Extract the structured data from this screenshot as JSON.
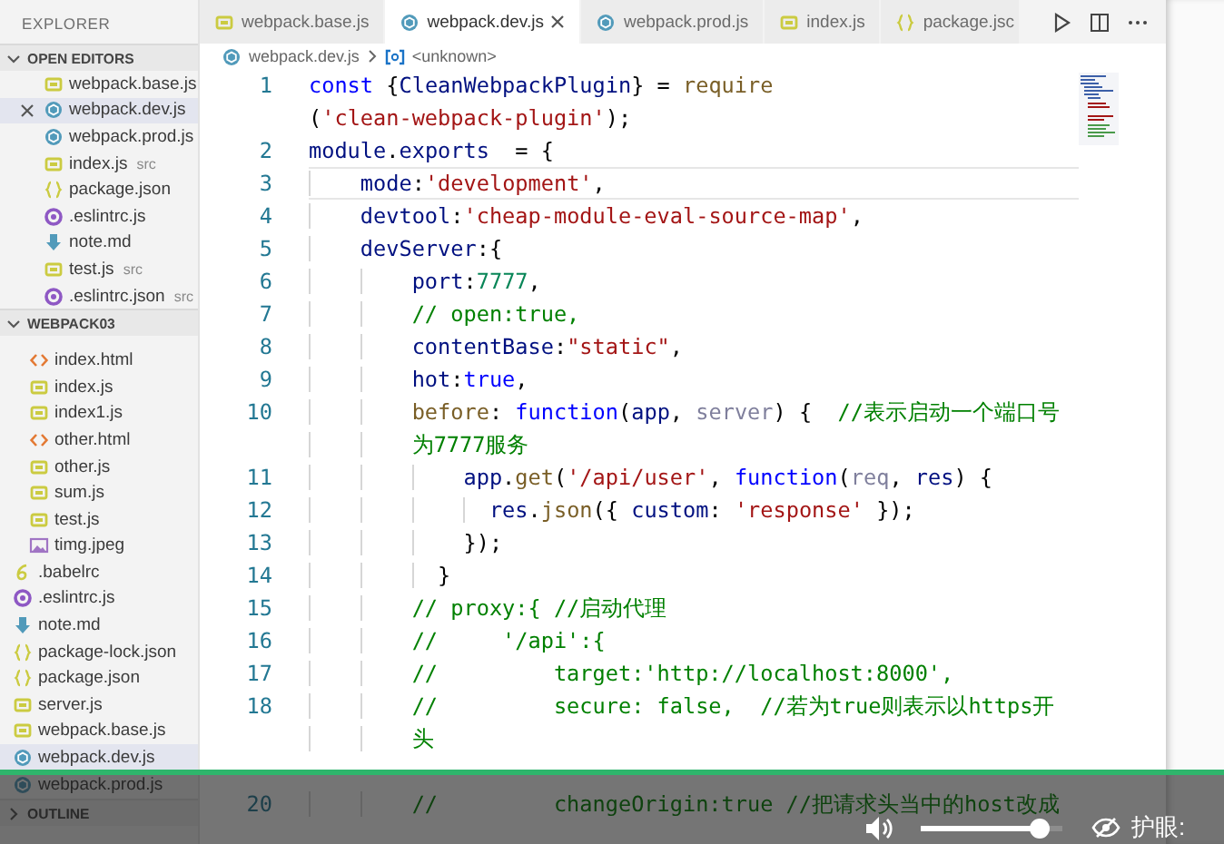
{
  "sidebar": {
    "title": "EXPLORER",
    "sections": [
      {
        "label": "OPEN EDITORS",
        "kind": "open-editors",
        "expanded": true,
        "items": [
          {
            "label": "webpack.base.js",
            "kind": "js",
            "selected": false
          },
          {
            "label": "webpack.dev.js",
            "kind": "webpack",
            "selected": true
          },
          {
            "label": "webpack.prod.js",
            "kind": "webpack",
            "selected": false
          },
          {
            "label": "index.js",
            "kind": "js",
            "description": "src",
            "selected": false
          },
          {
            "label": "package.json",
            "kind": "json",
            "selected": false
          },
          {
            "label": ".eslintrc.js",
            "kind": "eslint",
            "selected": false
          },
          {
            "label": "note.md",
            "kind": "markdown",
            "selected": false
          },
          {
            "label": "test.js",
            "kind": "js",
            "description": "src",
            "selected": false
          },
          {
            "label": ".eslintrc.json",
            "kind": "eslint",
            "description": "src",
            "selected": false
          }
        ]
      },
      {
        "label": "WEBPACK03",
        "kind": "folder",
        "expanded": true,
        "items": [
          {
            "children": [
              {
                "label": "index.html",
                "kind": "html",
                "selected": false
              },
              {
                "label": "index.js",
                "kind": "js",
                "selected": false
              },
              {
                "label": "index1.js",
                "kind": "js",
                "selected": false
              },
              {
                "label": "other.html",
                "kind": "html",
                "selected": false
              },
              {
                "label": "other.js",
                "kind": "js",
                "selected": false
              },
              {
                "label": "sum.js",
                "kind": "js",
                "selected": false
              },
              {
                "label": "test.js",
                "kind": "js",
                "selected": false
              },
              {
                "label": "timg.jpeg",
                "kind": "image",
                "selected": false
              }
            ]
          },
          {
            "label": ".babelrc",
            "kind": "babel",
            "selected": false
          },
          {
            "label": ".eslintrc.js",
            "kind": "eslint",
            "selected": false
          },
          {
            "label": "note.md",
            "kind": "markdown",
            "selected": false
          },
          {
            "label": "package-lock.json",
            "kind": "json",
            "selected": false
          },
          {
            "label": "package.json",
            "kind": "json",
            "selected": false
          },
          {
            "label": "server.js",
            "kind": "js",
            "selected": false
          },
          {
            "label": "webpack.base.js",
            "kind": "js",
            "selected": false
          },
          {
            "label": "webpack.dev.js",
            "kind": "webpack",
            "selected": true
          },
          {
            "label": "webpack.prod.js",
            "kind": "webpack",
            "selected": false
          }
        ]
      },
      {
        "label": "OUTLINE",
        "kind": "outline",
        "expanded": false
      }
    ]
  },
  "tabs": [
    {
      "label": "webpack.base.js",
      "kind": "js",
      "selected": false
    },
    {
      "label": "webpack.dev.js",
      "kind": "webpack",
      "selected": true
    },
    {
      "label": "webpack.prod.js",
      "kind": "webpack",
      "selected": false
    },
    {
      "label": "index.js",
      "kind": "js",
      "selected": false
    },
    {
      "label": "package.jsc",
      "kind": "json",
      "selected": false
    }
  ],
  "breadcrumb": {
    "file": "webpack.dev.js",
    "symbol": "<unknown>"
  },
  "code": {
    "lines": [
      {
        "number": "1",
        "current": false,
        "rows": [
          [
            {
              "text": "const",
              "kind": "keyword"
            },
            {
              "text": " {",
              "kind": "plain"
            },
            {
              "text": "CleanWebpackPlugin",
              "kind": "variable"
            },
            {
              "text": "} = ",
              "kind": "plain"
            },
            {
              "text": "require",
              "kind": "function"
            }
          ],
          [
            {
              "text": "(",
              "kind": "plain"
            },
            {
              "text": "'clean-webpack-plugin'",
              "kind": "string"
            },
            {
              "text": ");",
              "kind": "plain"
            }
          ]
        ]
      },
      {
        "number": "2",
        "current": false,
        "rows": [
          [
            {
              "text": "module",
              "kind": "variable"
            },
            {
              "text": ".",
              "kind": "plain"
            },
            {
              "text": "exports",
              "kind": "variable"
            },
            {
              "text": "  = {",
              "kind": "plain"
            }
          ]
        ]
      },
      {
        "number": "3",
        "current": true,
        "rows": [
          [
            {
              "text": "    ",
              "kind": "indent"
            },
            {
              "text": "mode",
              "kind": "variable"
            },
            {
              "text": ":",
              "kind": "plain"
            },
            {
              "text": "'development'",
              "kind": "string"
            },
            {
              "text": ",",
              "kind": "plain"
            }
          ]
        ]
      },
      {
        "number": "4",
        "current": false,
        "rows": [
          [
            {
              "text": "    ",
              "kind": "indent"
            },
            {
              "text": "devtool",
              "kind": "variable"
            },
            {
              "text": ":",
              "kind": "plain"
            },
            {
              "text": "'cheap-module-eval-source-map'",
              "kind": "string"
            },
            {
              "text": ",",
              "kind": "plain"
            }
          ]
        ]
      },
      {
        "number": "5",
        "current": false,
        "rows": [
          [
            {
              "text": "    ",
              "kind": "indent"
            },
            {
              "text": "devServer",
              "kind": "variable"
            },
            {
              "text": ":{",
              "kind": "plain"
            }
          ]
        ]
      },
      {
        "number": "6",
        "current": false,
        "rows": [
          [
            {
              "text": "        ",
              "kind": "indent"
            },
            {
              "text": "port",
              "kind": "variable"
            },
            {
              "text": ":",
              "kind": "plain"
            },
            {
              "text": "7777",
              "kind": "number"
            },
            {
              "text": ",",
              "kind": "plain"
            }
          ]
        ]
      },
      {
        "number": "7",
        "current": false,
        "rows": [
          [
            {
              "text": "        ",
              "kind": "indent"
            },
            {
              "text": "// open:true,",
              "kind": "comment"
            }
          ]
        ]
      },
      {
        "number": "8",
        "current": false,
        "rows": [
          [
            {
              "text": "        ",
              "kind": "indent"
            },
            {
              "text": "contentBase",
              "kind": "variable"
            },
            {
              "text": ":",
              "kind": "plain"
            },
            {
              "text": "\"static\"",
              "kind": "string"
            },
            {
              "text": ",",
              "kind": "plain"
            }
          ]
        ]
      },
      {
        "number": "9",
        "current": false,
        "rows": [
          [
            {
              "text": "        ",
              "kind": "indent"
            },
            {
              "text": "hot",
              "kind": "variable"
            },
            {
              "text": ":",
              "kind": "plain"
            },
            {
              "text": "true",
              "kind": "keyword"
            },
            {
              "text": ",",
              "kind": "plain"
            }
          ]
        ]
      },
      {
        "number": "10",
        "current": false,
        "rows": [
          [
            {
              "text": "        ",
              "kind": "indent"
            },
            {
              "text": "before",
              "kind": "function"
            },
            {
              "text": ": ",
              "kind": "plain"
            },
            {
              "text": "function",
              "kind": "keyword"
            },
            {
              "text": "(",
              "kind": "plain"
            },
            {
              "text": "app",
              "kind": "variable"
            },
            {
              "text": ", ",
              "kind": "plain"
            },
            {
              "text": "server",
              "kind": "unused"
            },
            {
              "text": ") {  ",
              "kind": "plain"
            },
            {
              "text": "//表示启动一个端口号",
              "kind": "comment"
            }
          ],
          [
            {
              "text": "        ",
              "kind": "indent"
            },
            {
              "text": "为7777服务",
              "kind": "comment"
            }
          ]
        ]
      },
      {
        "number": "11",
        "current": false,
        "rows": [
          [
            {
              "text": "            ",
              "kind": "indent"
            },
            {
              "text": "app",
              "kind": "variable"
            },
            {
              "text": ".",
              "kind": "plain"
            },
            {
              "text": "get",
              "kind": "function"
            },
            {
              "text": "(",
              "kind": "plain"
            },
            {
              "text": "'/api/user'",
              "kind": "string"
            },
            {
              "text": ", ",
              "kind": "plain"
            },
            {
              "text": "function",
              "kind": "keyword"
            },
            {
              "text": "(",
              "kind": "plain"
            },
            {
              "text": "req",
              "kind": "unused"
            },
            {
              "text": ", ",
              "kind": "plain"
            },
            {
              "text": "res",
              "kind": "variable"
            },
            {
              "text": ") {",
              "kind": "plain"
            }
          ]
        ]
      },
      {
        "number": "12",
        "current": false,
        "rows": [
          [
            {
              "text": "              ",
              "kind": "indent"
            },
            {
              "text": "res",
              "kind": "variable"
            },
            {
              "text": ".",
              "kind": "plain"
            },
            {
              "text": "json",
              "kind": "function"
            },
            {
              "text": "({ ",
              "kind": "plain"
            },
            {
              "text": "custom",
              "kind": "variable"
            },
            {
              "text": ": ",
              "kind": "plain"
            },
            {
              "text": "'response'",
              "kind": "string"
            },
            {
              "text": " });",
              "kind": "plain"
            }
          ]
        ]
      },
      {
        "number": "13",
        "current": false,
        "rows": [
          [
            {
              "text": "            ",
              "kind": "indent"
            },
            {
              "text": "});",
              "kind": "plain"
            }
          ]
        ]
      },
      {
        "number": "14",
        "current": false,
        "rows": [
          [
            {
              "text": "          ",
              "kind": "indent"
            },
            {
              "text": "}",
              "kind": "plain"
            }
          ]
        ]
      },
      {
        "number": "15",
        "current": false,
        "rows": [
          [
            {
              "text": "        ",
              "kind": "indent"
            },
            {
              "text": "// proxy:{ //启动代理",
              "kind": "comment"
            }
          ]
        ]
      },
      {
        "number": "16",
        "current": false,
        "rows": [
          [
            {
              "text": "        ",
              "kind": "indent"
            },
            {
              "text": "//     '/api':{",
              "kind": "comment"
            }
          ]
        ]
      },
      {
        "number": "17",
        "current": false,
        "rows": [
          [
            {
              "text": "        ",
              "kind": "indent"
            },
            {
              "text": "//         target:'http://localhost:8000',",
              "kind": "comment"
            }
          ]
        ]
      },
      {
        "number": "18",
        "current": false,
        "rows": [
          [
            {
              "text": "        ",
              "kind": "indent"
            },
            {
              "text": "//         secure: false,  //若为true则表示以https开",
              "kind": "comment"
            }
          ],
          [
            {
              "text": "        ",
              "kind": "indent"
            },
            {
              "text": "头",
              "kind": "comment"
            }
          ]
        ]
      },
      {
        "number": "20",
        "current": false,
        "rows": [
          [
            {
              "text": "        ",
              "kind": "indent"
            },
            {
              "text": "//         changeOrigin:true //把请求头当中的host改成",
              "kind": "comment"
            }
          ]
        ]
      }
    ]
  },
  "player": {
    "volume": {
      "level": 0.9
    },
    "toggle_label": "护眼:"
  }
}
